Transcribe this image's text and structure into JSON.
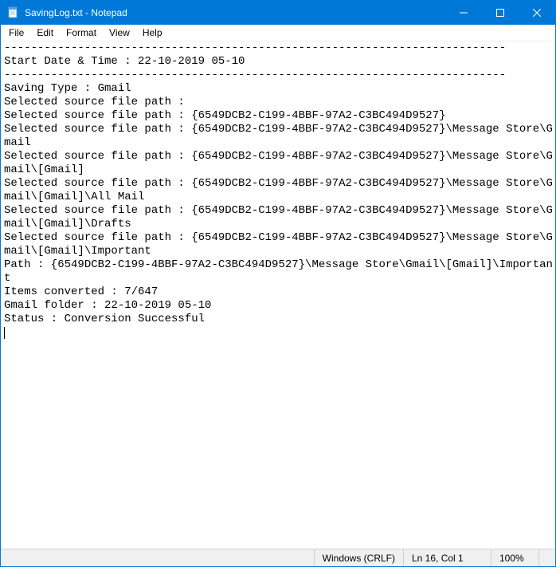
{
  "window": {
    "title": "SavingLog.txt - Notepad"
  },
  "menu": {
    "file": "File",
    "edit": "Edit",
    "format": "Format",
    "view": "View",
    "help": "Help"
  },
  "editor": {
    "content": "---------------------------------------------------------------------------\nStart Date & Time : 22-10-2019 05-10\n---------------------------------------------------------------------------\nSaving Type : Gmail\nSelected source file path : \nSelected source file path : {6549DCB2-C199-4BBF-97A2-C3BC494D9527}\nSelected source file path : {6549DCB2-C199-4BBF-97A2-C3BC494D9527}\\Message Store\\Gmail\nSelected source file path : {6549DCB2-C199-4BBF-97A2-C3BC494D9527}\\Message Store\\Gmail\\[Gmail]\nSelected source file path : {6549DCB2-C199-4BBF-97A2-C3BC494D9527}\\Message Store\\Gmail\\[Gmail]\\All Mail\nSelected source file path : {6549DCB2-C199-4BBF-97A2-C3BC494D9527}\\Message Store\\Gmail\\[Gmail]\\Drafts\nSelected source file path : {6549DCB2-C199-4BBF-97A2-C3BC494D9527}\\Message Store\\Gmail\\[Gmail]\\Important\nPath : {6549DCB2-C199-4BBF-97A2-C3BC494D9527}\\Message Store\\Gmail\\[Gmail]\\Important\nItems converted : 7/647\nGmail folder : 22-10-2019 05-10\nStatus : Conversion Successful\n"
  },
  "status": {
    "encoding": "Windows (CRLF)",
    "position": "Ln 16, Col 1",
    "zoom": "100%"
  }
}
